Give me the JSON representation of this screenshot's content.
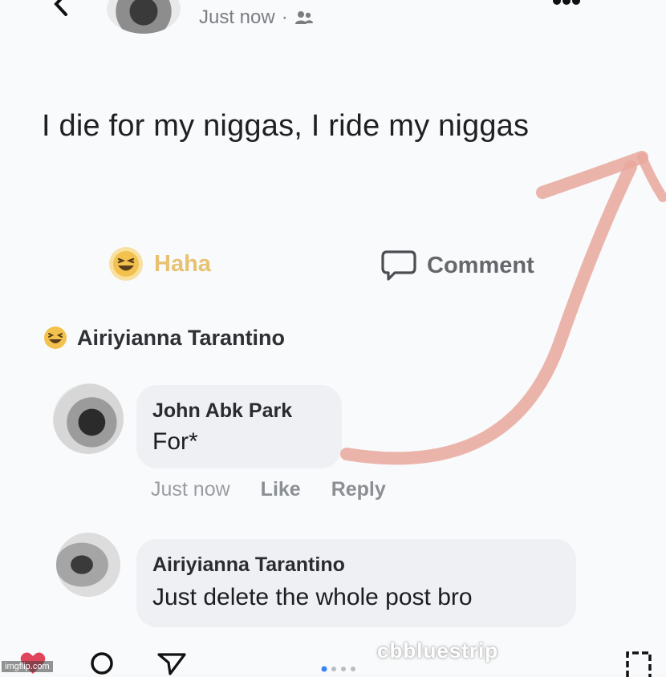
{
  "header": {
    "timestamp": "Just now",
    "separator": "·",
    "back_icon": "chevron-left-icon",
    "audience_icon": "friends-icon",
    "more_icon": "more-horizontal-icon"
  },
  "post": {
    "text": "I die for my niggas, I ride my niggas"
  },
  "actions": {
    "reaction_label": "Haha",
    "reaction_icon": "haha-emoji-icon",
    "comment_label": "Comment",
    "comment_icon": "comment-icon"
  },
  "reactor": {
    "name": "Airiyianna Tarantino",
    "icon": "haha-emoji-icon"
  },
  "comments": [
    {
      "author": "John Abk Park",
      "text": "For*",
      "time": "Just now",
      "like_label": "Like",
      "reply_label": "Reply"
    },
    {
      "author": "Airiyianna Tarantino",
      "text": "Just delete the whole post bro"
    }
  ],
  "footer": {
    "watermark": "cbbluestrip",
    "imgflip": "imgflip.com"
  },
  "colors": {
    "haha": "#e6b95b",
    "annotation_arrow": "#e9a79c",
    "bubble": "#eef0f4",
    "muted_text": "#65676b"
  }
}
